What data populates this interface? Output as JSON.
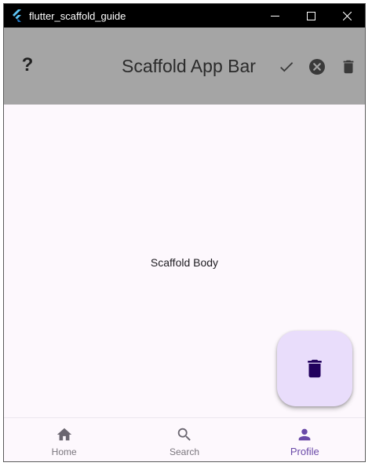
{
  "window": {
    "title": "flutter_scaffold_guide",
    "controls": [
      "minimize",
      "maximize",
      "close"
    ]
  },
  "appbar": {
    "leading_label": "?",
    "title": "Scaffold App Bar",
    "actions": [
      "check-icon",
      "cancel-icon",
      "delete-icon"
    ]
  },
  "body": {
    "text": "Scaffold Body"
  },
  "fab": {
    "icon": "delete-icon"
  },
  "bottom_nav": {
    "items": [
      {
        "label": "Home",
        "icon": "home-icon",
        "active": false
      },
      {
        "label": "Search",
        "icon": "search-icon",
        "active": false
      },
      {
        "label": "Profile",
        "icon": "person-icon",
        "active": true
      }
    ]
  },
  "colors": {
    "appbar_bg": "#a5a5a5",
    "body_bg": "#fdf8fd",
    "fab_bg": "#e9ddfb",
    "fab_icon": "#21005d",
    "active_nav": "#6a4aa8",
    "inactive_nav": "#7a767d"
  }
}
